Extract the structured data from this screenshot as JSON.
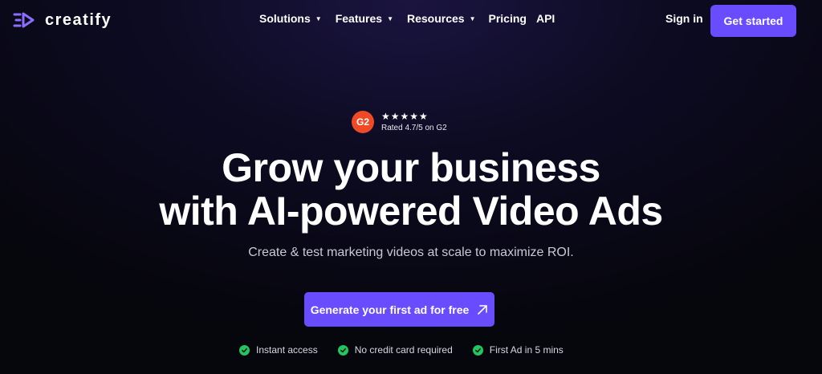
{
  "brand": {
    "name": "creatify",
    "icon": "creatify-logo-icon",
    "accent": "#6a4cff"
  },
  "nav": {
    "items": [
      {
        "label": "Solutions",
        "has_dropdown": true
      },
      {
        "label": "Features",
        "has_dropdown": true
      },
      {
        "label": "Resources",
        "has_dropdown": true
      },
      {
        "label": "Pricing",
        "has_dropdown": false
      },
      {
        "label": "API",
        "has_dropdown": false
      }
    ],
    "signin_label": "Sign in",
    "get_started_label": "Get started"
  },
  "rating": {
    "badge_label": "G2",
    "stars": "★★★★★",
    "text": "Rated 4.7/5 on G2"
  },
  "hero": {
    "headline_line1": "Grow your business",
    "headline_line2": "with AI-powered Video Ads",
    "subhead": "Create & test marketing videos at scale to maximize ROI.",
    "cta_label": "Generate your first ad for free",
    "cta_icon": "arrow-up-right-icon"
  },
  "features": [
    {
      "label": "Instant access",
      "icon": "check-circle-icon"
    },
    {
      "label": "No credit card required",
      "icon": "check-circle-icon"
    },
    {
      "label": "First Ad in 5 mins",
      "icon": "check-circle-icon"
    }
  ],
  "colors": {
    "primary_button": "#6a4cff",
    "check": "#22c55e",
    "g2_badge": "#ef4a25"
  }
}
